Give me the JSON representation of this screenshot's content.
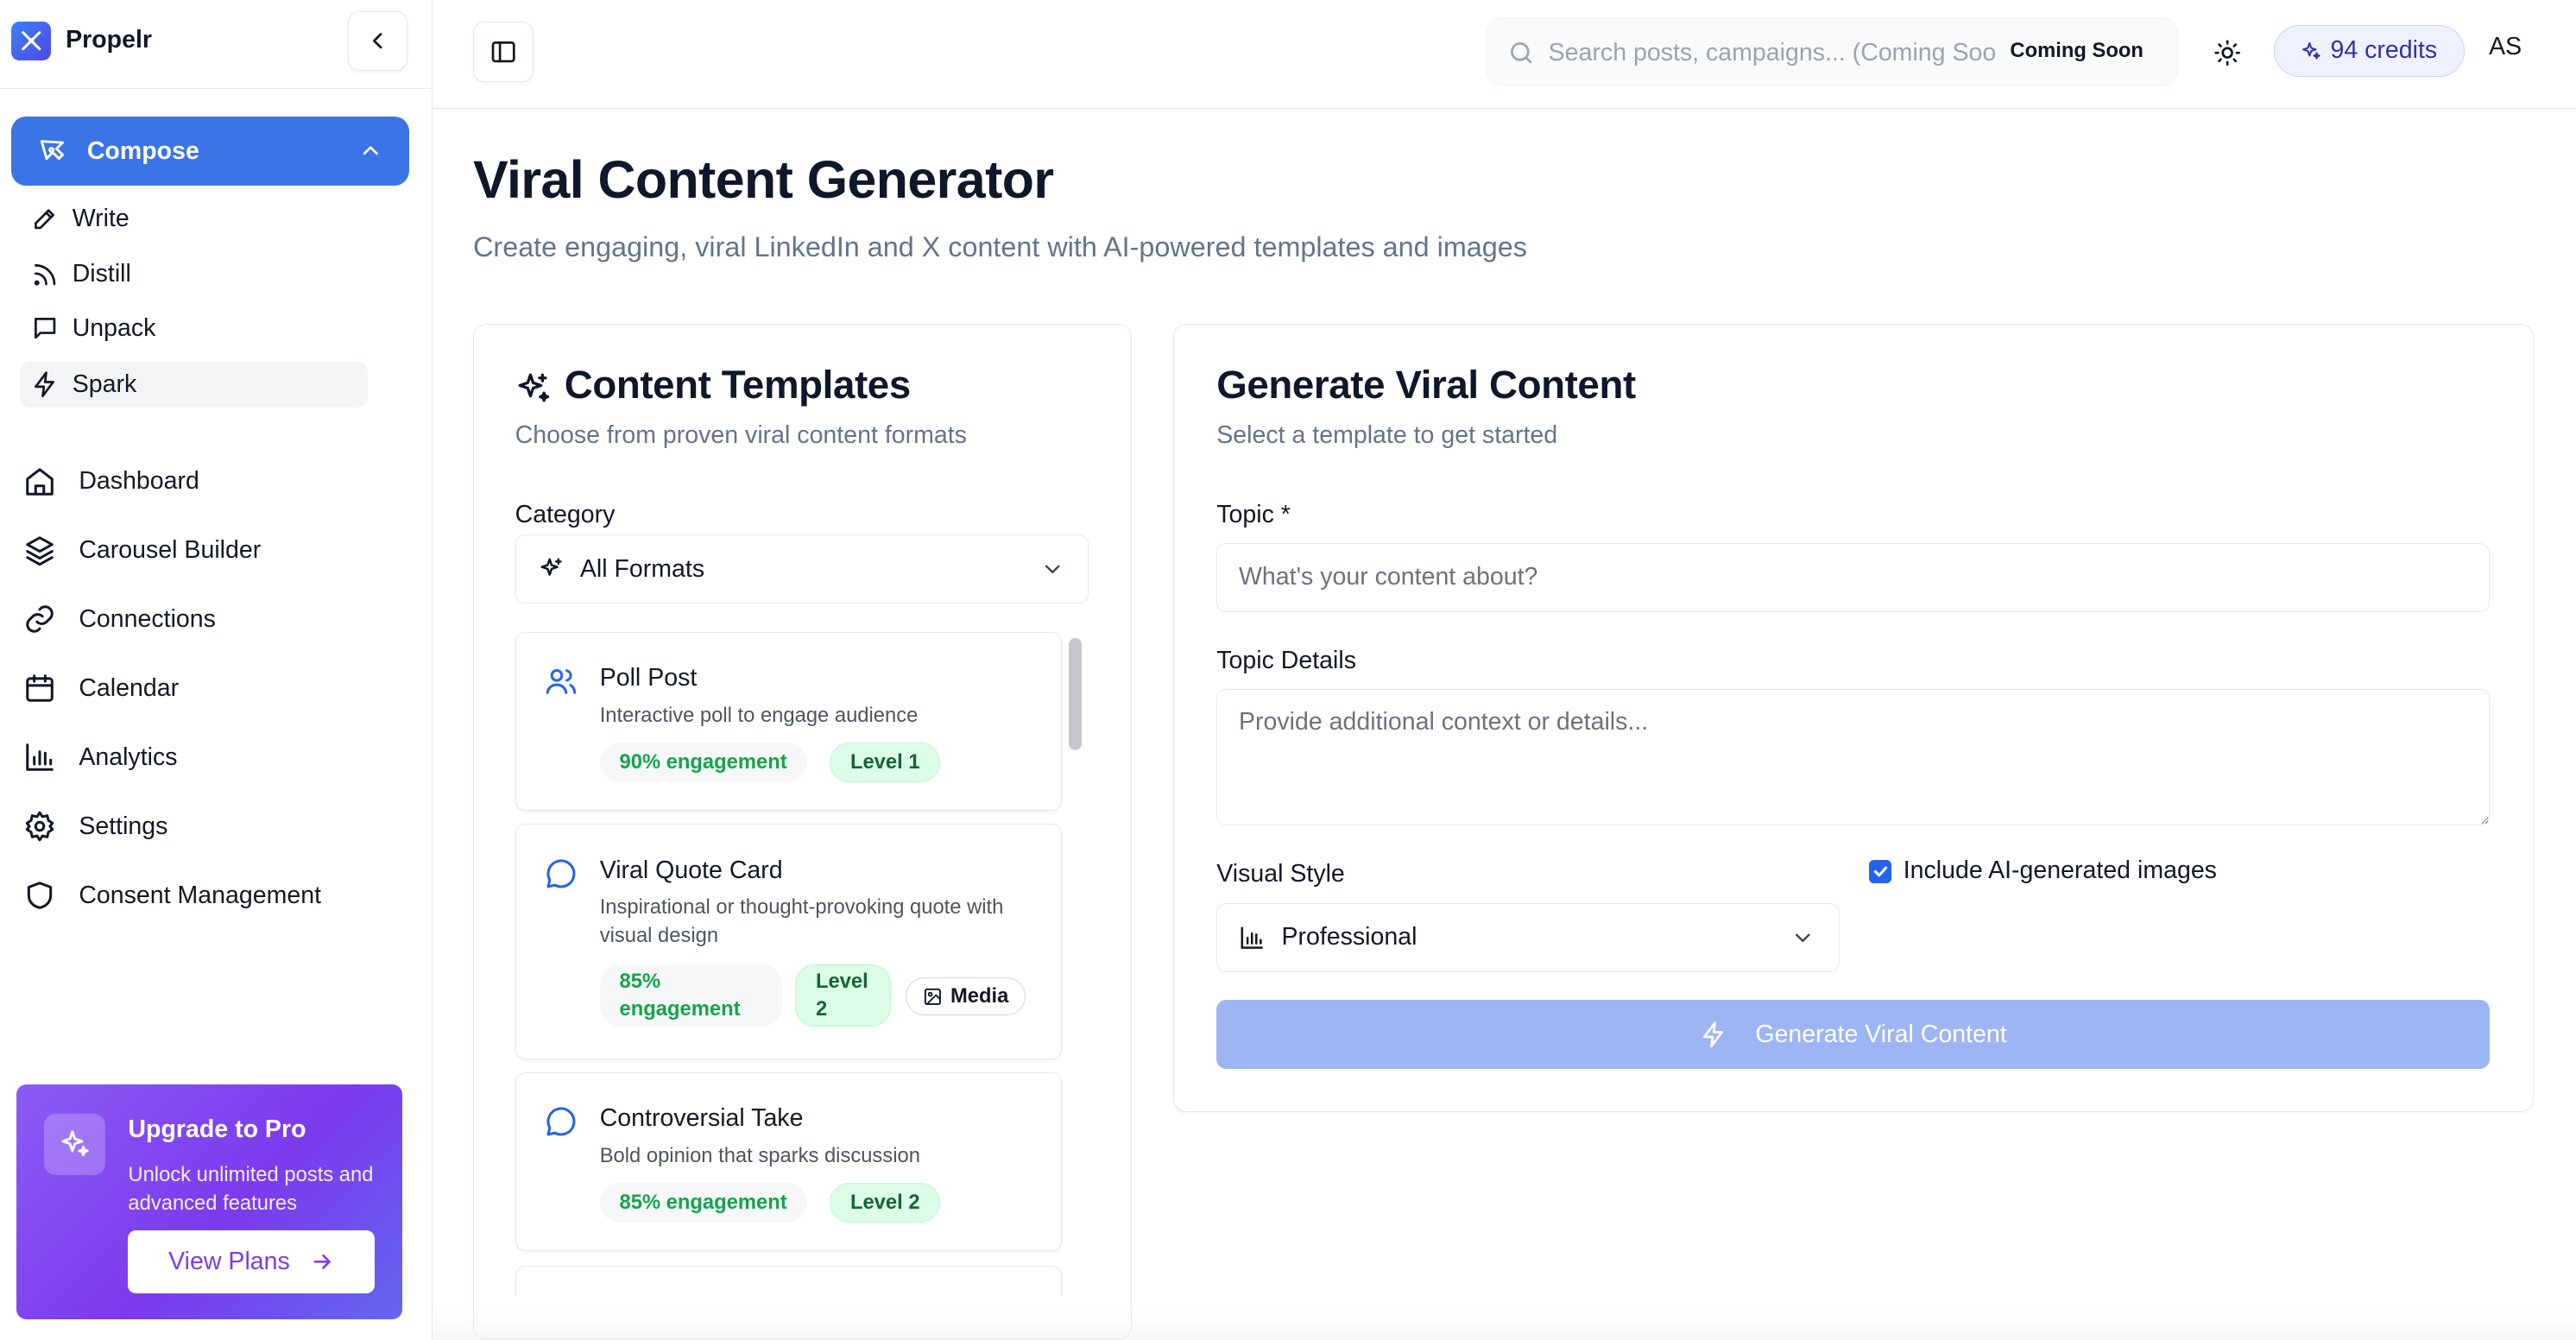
{
  "brand": {
    "name": "Propelr"
  },
  "sidebar": {
    "compose": {
      "label": "Compose",
      "items": [
        {
          "label": "Write",
          "icon": "pen-icon"
        },
        {
          "label": "Distill",
          "icon": "rss-icon"
        },
        {
          "label": "Unpack",
          "icon": "message-square-icon"
        },
        {
          "label": "Spark",
          "icon": "lightning-icon"
        }
      ]
    },
    "nav": [
      {
        "label": "Dashboard",
        "icon": "home-icon"
      },
      {
        "label": "Carousel Builder",
        "icon": "layers-icon"
      },
      {
        "label": "Connections",
        "icon": "link-icon"
      },
      {
        "label": "Calendar",
        "icon": "calendar-icon"
      },
      {
        "label": "Analytics",
        "icon": "bar-chart-icon"
      },
      {
        "label": "Settings",
        "icon": "gear-icon"
      },
      {
        "label": "Consent Management",
        "icon": "shield-icon"
      }
    ],
    "upgrade": {
      "title": "Upgrade to Pro",
      "description": "Unlock unlimited posts and advanced features",
      "button": "View Plans"
    }
  },
  "header": {
    "search": {
      "placeholder": "Search posts, campaigns... (Coming Soon)",
      "badge": "Coming Soon"
    },
    "credits": "94 credits",
    "avatar": "AS"
  },
  "page": {
    "title": "Viral Content Generator",
    "subtitle": "Create engaging, viral LinkedIn and X content with AI-powered templates and images"
  },
  "templates": {
    "title": "Content Templates",
    "subtitle": "Choose from proven viral content formats",
    "category_label": "Category",
    "category_value": "All Formats",
    "items": [
      {
        "title": "Poll Post",
        "description": "Interactive poll to engage audience",
        "engagement": "90% engagement",
        "level": "Level 1",
        "icon": "users-icon"
      },
      {
        "title": "Viral Quote Card",
        "description": "Inspirational or thought-provoking quote with visual design",
        "engagement": "85% engagement",
        "level": "Level 2",
        "media": "Media",
        "icon": "message-circle-icon"
      },
      {
        "title": "Controversial Take",
        "description": "Bold opinion that sparks discussion",
        "engagement": "85% engagement",
        "level": "Level 2",
        "icon": "message-circle-icon"
      }
    ]
  },
  "generator": {
    "title": "Generate Viral Content",
    "subtitle": "Select a template to get started",
    "topic_label": "Topic *",
    "topic_placeholder": "What's your content about?",
    "details_label": "Topic Details",
    "details_placeholder": "Provide additional context or details...",
    "style_label": "Visual Style",
    "style_value": "Professional",
    "include_images_label": "Include AI-generated images",
    "include_images_checked": true,
    "button": "Generate Viral Content"
  },
  "colors": {
    "accent": "#3b74e6",
    "button_disabled": "#9db5f2",
    "upgrade_gradient_start": "#8b5cf6",
    "upgrade_gradient_end": "#6366f1",
    "engagement_text": "#16a34a",
    "level_bg": "#dcfce7"
  }
}
